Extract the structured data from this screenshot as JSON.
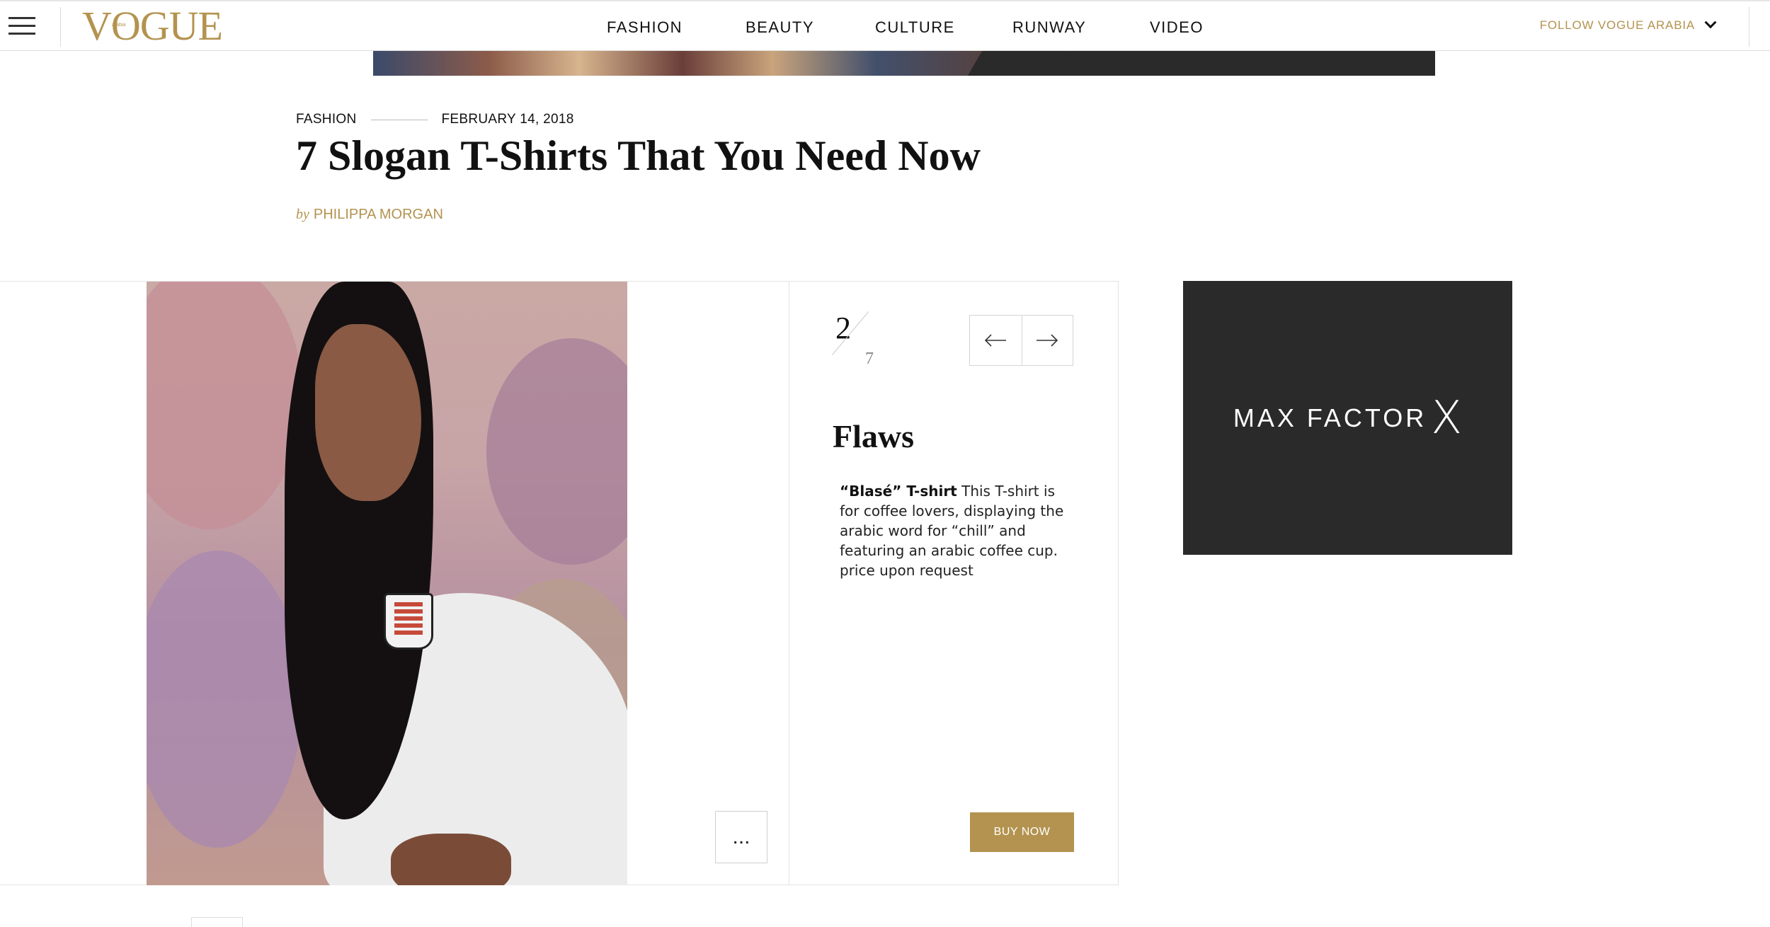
{
  "nav": {
    "logo": "VOGUE",
    "logo_sub": "arabia",
    "links": [
      "FASHION",
      "BEAUTY",
      "CULTURE",
      "RUNWAY",
      "VIDEO"
    ],
    "follow": "FOLLOW VOGUE ARABIA",
    "menu_icon": "hamburger-icon",
    "follow_icon": "chevron-down-icon"
  },
  "article": {
    "category": "FASHION",
    "date": "FEBRUARY 14, 2018",
    "title": "7 Slogan T-Shirts That You Need Now",
    "by": "by",
    "author": "PHILIPPA MORGAN"
  },
  "gallery": {
    "current": "2",
    "total": "7",
    "prev_icon": "arrow-left-icon",
    "next_icon": "arrow-right-icon",
    "more_label": "...",
    "heading": "Flaws",
    "item_name": "“Blasé” T-shirt",
    "item_desc": "This T-shirt is for coffee lovers, displaying the arabic word for “chill” and featuring an arabic coffee cup. price upon request",
    "buy_label": "BUY NOW"
  },
  "ad": {
    "brand": "MAX FACTOR",
    "mark": "X"
  },
  "colors": {
    "accent_gold": "#b3934f",
    "ad_bg": "#2b2a2b"
  }
}
